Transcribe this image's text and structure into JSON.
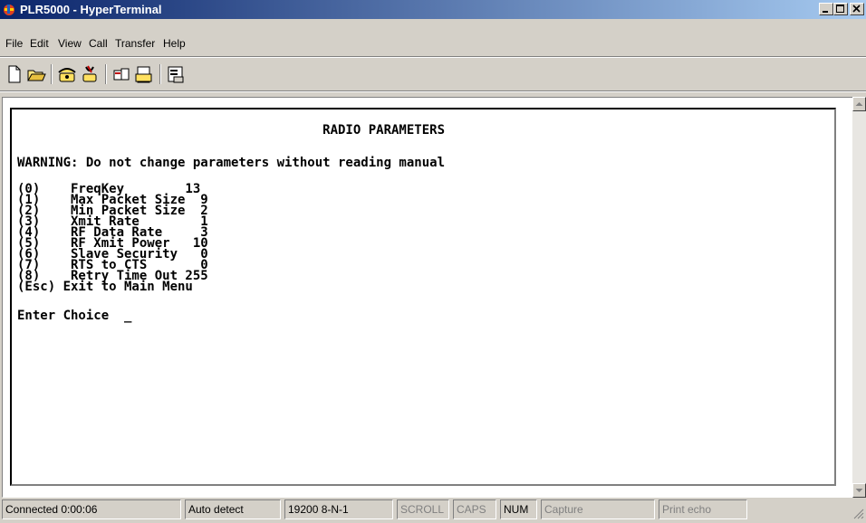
{
  "window": {
    "title": "PLR5000 - HyperTerminal",
    "app_icon": "hyperterminal-icon",
    "controls": [
      "minimize-icon",
      "maximize-icon",
      "close-icon"
    ]
  },
  "menu": {
    "items": [
      {
        "label": "File"
      },
      {
        "label": "Edit"
      },
      {
        "label": "View"
      },
      {
        "label": "Call"
      },
      {
        "label": "Transfer"
      },
      {
        "label": "Help"
      }
    ]
  },
  "toolbar": {
    "icons": [
      "new-icon",
      "open-icon",
      "call-icon",
      "disconnect-icon",
      "send-icon",
      "receive-icon",
      "properties-icon"
    ]
  },
  "terminal": {
    "lines": [
      "                                        RADIO PARAMETERS",
      "",
      "WARNING: Do not change parameters without reading manual",
      "",
      "(0)    FreqKey        13",
      "(1)    Max Packet Size  9",
      "(2)    Min Packet Size  2",
      "(3)    Xmit Rate        1",
      "(4)    RF Data Rate     3",
      "(5)    RF Xmit Power   10",
      "(6)    Slave Security   0",
      "(7)    RTS to CTS       0",
      "(8)    Retry Time Out 255",
      "(Esc) Exit to Main Menu",
      "",
      "Enter Choice  _"
    ]
  },
  "status": {
    "connected": "Connected 0:00:06",
    "emulation": "Auto detect",
    "settings": "19200 8-N-1",
    "scroll": "SCROLL",
    "caps": "CAPS",
    "num": "NUM",
    "capture": "Capture",
    "print_echo": "Print echo"
  },
  "colors": {
    "title_start": "#0a246a",
    "title_end": "#a6caf0",
    "chrome": "#d4d0c8",
    "terminal_text": "#000000"
  }
}
